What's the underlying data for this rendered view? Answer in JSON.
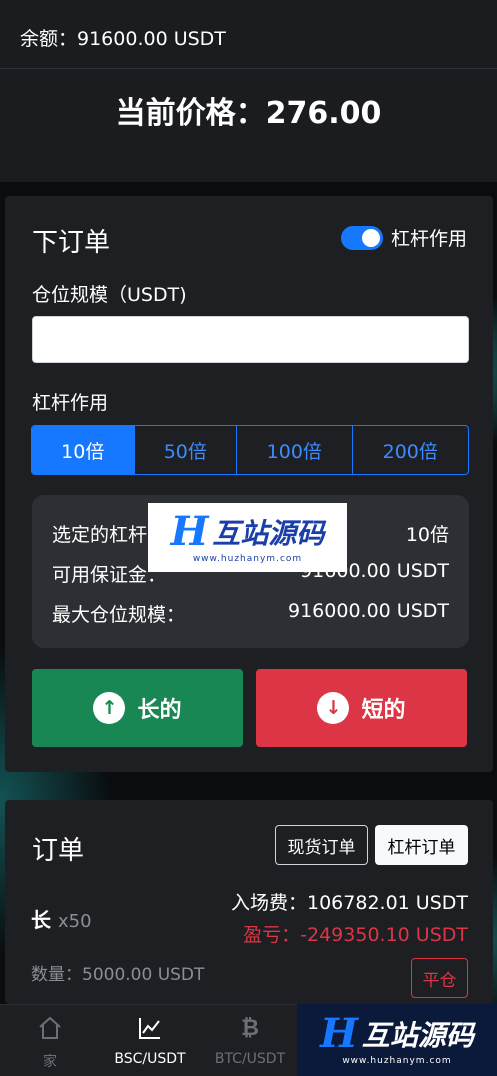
{
  "header": {
    "balance": "余额：91600.00 USDT",
    "current_price": "当前价格：276.00"
  },
  "order_form": {
    "title": "下订单",
    "leverage_toggle_label": "杠杆作用",
    "leverage_toggle_on": true,
    "position_size_label": "仓位规模（USDT)",
    "position_size_value": "",
    "leverage_label": "杠杆作用",
    "leverage_options": [
      "10倍",
      "50倍",
      "100倍",
      "200倍"
    ],
    "leverage_selected": "10倍",
    "info": {
      "selected_leverage_label": "选定的杠杆：",
      "selected_leverage_value": "10倍",
      "available_margin_label": "可用保证金：",
      "available_margin_value": "91600.00 USDT",
      "max_position_label": "最大仓位规模：",
      "max_position_value": "916000.00 USDT"
    },
    "long_button": "长的",
    "short_button": "短的"
  },
  "orders": {
    "title": "订单",
    "tab_spot": "现货订单",
    "tab_leverage": "杠杆订单",
    "position": {
      "side": "长",
      "multiplier": "x50",
      "entry_fee": "入场费：106782.01 USDT",
      "pnl": "盈亏：-249350.10 USDT",
      "quantity": "数量：5000.00 USDT",
      "close_button": "平仓"
    }
  },
  "bottom_nav": [
    {
      "label": "家",
      "icon": "home-icon",
      "active": false
    },
    {
      "label": "BSC/USDT",
      "icon": "chart-line-icon",
      "active": true
    },
    {
      "label": "BTC/USDT",
      "icon": "bitcoin-icon",
      "active": false
    }
  ],
  "watermark": {
    "brand": "互站源码",
    "url": "www.huzhanym.com"
  },
  "colors": {
    "primary": "#1677ff",
    "success": "#198754",
    "danger": "#dc3545",
    "card_bg": "#1d1f22"
  }
}
